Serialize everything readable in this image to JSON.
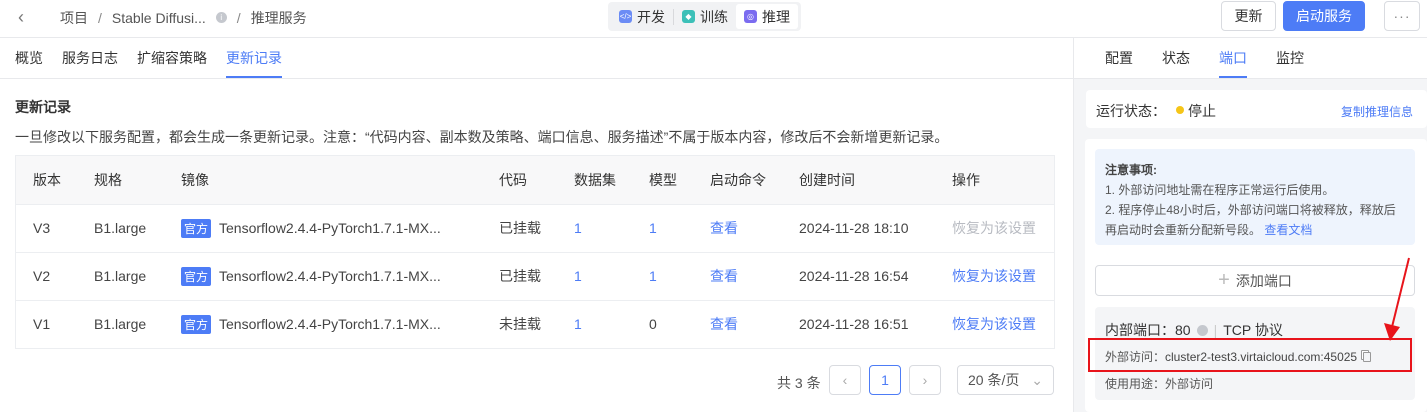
{
  "header": {
    "back_icon": "chevron-left-icon",
    "breadcrumb": [
      "项目",
      "Stable Diffusi...",
      "推理服务"
    ],
    "modes": [
      {
        "label": "开发",
        "icon": "code-icon",
        "color": "#6b8cf5"
      },
      {
        "label": "训练",
        "icon": "train-icon",
        "color": "#3cc0b8"
      },
      {
        "label": "推理",
        "icon": "inference-icon",
        "color": "#7b6cf0",
        "active": true
      }
    ],
    "update_label": "更新",
    "start_label": "启动服务",
    "more_label": "···"
  },
  "tabs": [
    "概览",
    "服务日志",
    "扩缩容策略",
    "更新记录"
  ],
  "active_tab": "更新记录",
  "section": {
    "title": "更新记录",
    "description": "一旦修改以下服务配置，都会生成一条更新记录。注意：“代码内容、副本数及策略、端口信息、服务描述”不属于版本内容，修改后不会新增更新记录。"
  },
  "table": {
    "columns": [
      "版本",
      "规格",
      "镜像",
      "代码",
      "数据集",
      "模型",
      "启动命令",
      "创建时间",
      "操作"
    ],
    "rows": [
      {
        "version": "V3",
        "spec": "B1.large",
        "tag": "官方",
        "image": "Tensorflow2.4.4-PyTorch1.7.1-MX...",
        "code": "已挂载",
        "dataset": "1",
        "model": "1",
        "cmd": "查看",
        "created": "2024-11-28 18:10",
        "action": "恢复为该设置",
        "action_disabled": true
      },
      {
        "version": "V2",
        "spec": "B1.large",
        "tag": "官方",
        "image": "Tensorflow2.4.4-PyTorch1.7.1-MX...",
        "code": "已挂载",
        "dataset": "1",
        "model": "1",
        "cmd": "查看",
        "created": "2024-11-28 16:54",
        "action": "恢复为该设置",
        "action_disabled": false
      },
      {
        "version": "V1",
        "spec": "B1.large",
        "tag": "官方",
        "image": "Tensorflow2.4.4-PyTorch1.7.1-MX...",
        "code": "未挂载",
        "dataset": "1",
        "model": "0",
        "cmd": "查看",
        "created": "2024-11-28 16:51",
        "action": "恢复为该设置",
        "action_disabled": false
      }
    ]
  },
  "pagination": {
    "total": "共 3 条",
    "current": "1",
    "page_size": "20 条/页"
  },
  "right": {
    "tabs": [
      "配置",
      "状态",
      "端口",
      "监控"
    ],
    "active_tab": "端口",
    "status_label": "运行状态：",
    "status": "停止",
    "status_color": "#f5c518",
    "copy_link": "复制推理信息",
    "notice_title": "注意事项:",
    "notice_1": "1. 外部访问地址需在程序正常运行后使用。",
    "notice_2": "2. 程序停止48小时后，外部访问端口将被释放，释放后再启动时会重新分配新号段。",
    "notice_link": "查看文档",
    "add_port": "添加端口",
    "port": {
      "internal_label": "内部端口：",
      "internal": "80",
      "protocol": "TCP 协议",
      "external_label": "外部访问：",
      "external": "cluster2-test3.virtaicloud.com:45025",
      "usage_label": "使用用途：",
      "usage": "外部访问"
    }
  },
  "annotation_color": "#e8141b"
}
